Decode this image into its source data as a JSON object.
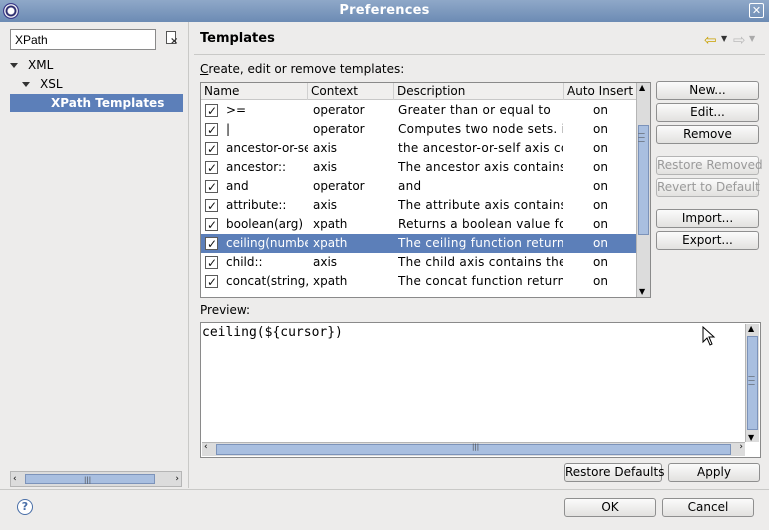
{
  "window": {
    "title": "Preferences"
  },
  "filter": {
    "value": "XPath"
  },
  "tree": [
    {
      "label": "XML"
    },
    {
      "label": "XSL"
    },
    {
      "label": "XPath Templates"
    }
  ],
  "page": {
    "title": "Templates",
    "description": "Create, edit or remove templates:",
    "description_mnemonic": "C",
    "description_rest": "reate, edit or remove templates:"
  },
  "table": {
    "columns": [
      "Name",
      "Context",
      "Description",
      "Auto Insert"
    ],
    "rows": [
      {
        "name": ">=",
        "context": "operator",
        "description": "Greater than or equal to",
        "auto": "on",
        "checked": true,
        "selected": false
      },
      {
        "name": "|",
        "context": "operator",
        "description": "Computes two node sets. i.e",
        "auto": "on",
        "checked": true,
        "selected": false
      },
      {
        "name": "ancestor-or-se",
        "context": "axis",
        "description": "the ancestor-or-self axis cont",
        "auto": "on",
        "checked": true,
        "selected": false
      },
      {
        "name": "ancestor::",
        "context": "axis",
        "description": "The ancestor axis contains th",
        "auto": "on",
        "checked": true,
        "selected": false
      },
      {
        "name": "and",
        "context": "operator",
        "description": "and",
        "auto": "on",
        "checked": true,
        "selected": false
      },
      {
        "name": "attribute::",
        "context": "axis",
        "description": "The attribute axis contains th",
        "auto": "on",
        "checked": true,
        "selected": false
      },
      {
        "name": "boolean(arg)",
        "context": "xpath",
        "description": "Returns a boolean value for a",
        "auto": "on",
        "checked": true,
        "selected": false
      },
      {
        "name": "ceiling(number",
        "context": "xpath",
        "description": "The ceiling function returns t",
        "auto": "on",
        "checked": true,
        "selected": true
      },
      {
        "name": "child::",
        "context": "axis",
        "description": "The child axis contains the ch",
        "auto": "on",
        "checked": true,
        "selected": false
      },
      {
        "name": "concat(string,",
        "context": "xpath",
        "description": "The concat function returns t",
        "auto": "on",
        "checked": true,
        "selected": false
      }
    ]
  },
  "buttons": {
    "new": "New...",
    "edit": "Edit...",
    "remove": "Remove",
    "restore_removed": "Restore Removed",
    "revert_default": "Revert to Default",
    "import": "Import...",
    "export": "Export...",
    "restore_defaults": "Restore Defaults",
    "apply": "Apply",
    "ok": "OK",
    "cancel": "Cancel"
  },
  "preview": {
    "label": "Preview:",
    "content": "ceiling(${cursor})"
  },
  "icons": {
    "app": "eclipse-icon",
    "close": "close-icon",
    "back": "back-arrow-icon",
    "forward": "forward-arrow-icon",
    "help": "help-icon",
    "clear_filter": "clear-filter-icon"
  },
  "colors": {
    "selection": "#5c7fb9",
    "titlebar": "#7c98bf"
  }
}
